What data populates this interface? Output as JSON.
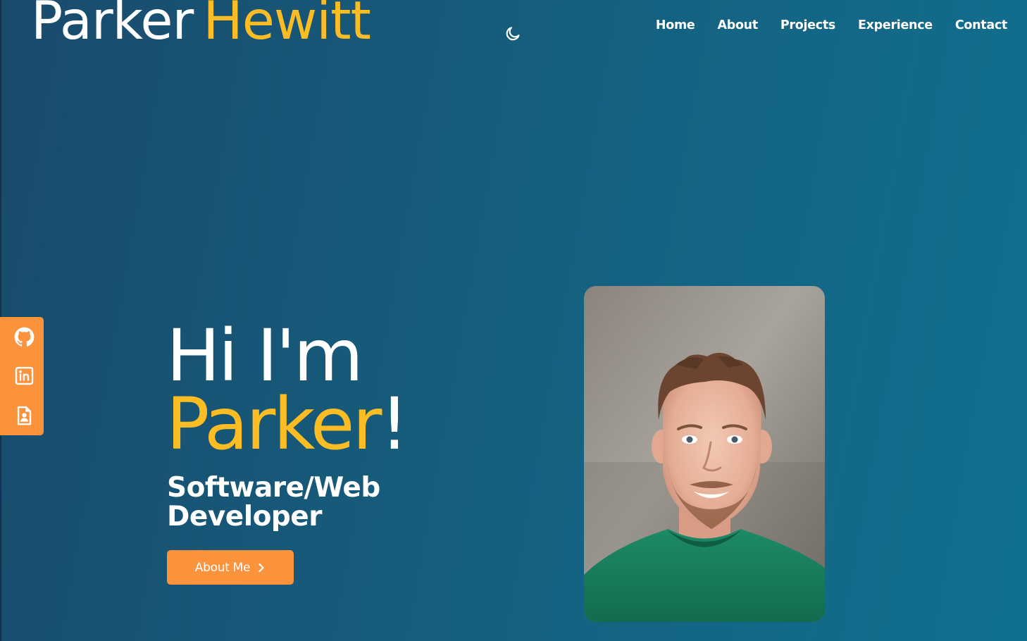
{
  "colors": {
    "accent": "#fbbd23",
    "button": "#fb923c",
    "background_start": "#1a4a6c",
    "background_end": "#11708f"
  },
  "header": {
    "brand_first": "Parker",
    "brand_last": "Hewitt",
    "theme_toggle_icon": "moon-icon",
    "nav": [
      "Home",
      "About",
      "Projects",
      "Experience",
      "Contact"
    ]
  },
  "social_icons": [
    "github-icon",
    "linkedin-icon",
    "resume-icon"
  ],
  "hero": {
    "greeting": "Hi I'm",
    "name": "Parker",
    "exclamation": "!",
    "subtitle": "Software/Web Developer",
    "cta_label": "About Me",
    "cta_icon": "chevron-right-icon",
    "photo": "portrait-photo"
  }
}
